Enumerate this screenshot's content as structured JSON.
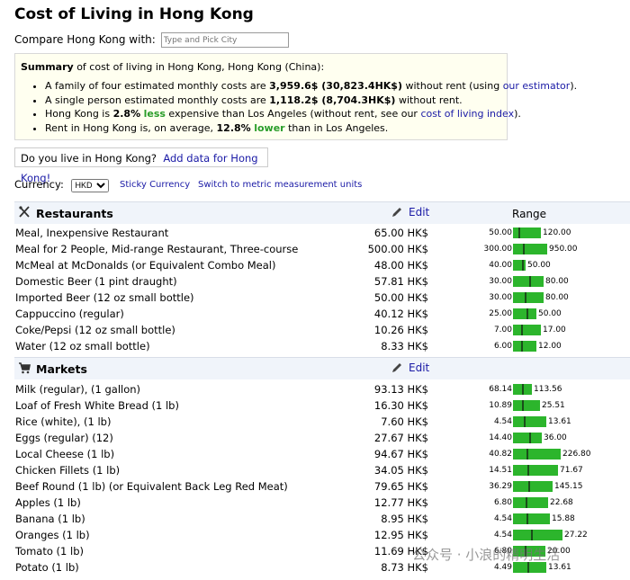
{
  "title": "Cost of Living in Hong Kong",
  "compare": {
    "label": "Compare Hong Kong with:",
    "placeholder": "Type and Pick City"
  },
  "summary": {
    "head_bold": "Summary",
    "head_rest": " of cost of living in Hong Kong, Hong Kong (China):",
    "l1_a": "A family of four estimated monthly costs are ",
    "l1_b": "3,959.6$ (30,823.4HK$)",
    "l1_c": " without rent (using ",
    "l1_link": "our estimator",
    "l1_d": ").",
    "l2_a": "A single person estimated monthly costs are ",
    "l2_b": "1,118.2$ (8,704.3HK$)",
    "l2_c": " without rent.",
    "l3_a": "Hong Kong is ",
    "l3_b": "2.8%",
    "l3_green": "less",
    "l3_c": " expensive than Los Angeles (without rent, see our ",
    "l3_link": "cost of living index",
    "l3_d": ").",
    "l4_a": "Rent in Hong Kong is, on average, ",
    "l4_b": "12.8%",
    "l4_green": "lower",
    "l4_c": " than in Los Angeles."
  },
  "live": {
    "text": "Do you live in Hong Kong?",
    "link": "Add data for Hong Kong!"
  },
  "currency": {
    "label": "Currency:",
    "value": "HKD",
    "sticky": "Sticky Currency",
    "metric": "Switch to metric measurement units"
  },
  "restaurants": {
    "title": "Restaurants",
    "edit": "Edit",
    "range": "Range",
    "rows": [
      {
        "name": "Meal, Inexpensive Restaurant",
        "price": "65.00 HK$",
        "lo": "50.00",
        "hi": "120.00",
        "lo_v": 50,
        "avg_v": 65,
        "hi_v": 120
      },
      {
        "name": "Meal for 2 People, Mid-range Restaurant, Three-course",
        "price": "500.00 HK$",
        "lo": "300.00",
        "hi": "950.00",
        "lo_v": 300,
        "avg_v": 500,
        "hi_v": 950
      },
      {
        "name": "McMeal at McDonalds (or Equivalent Combo Meal)",
        "price": "48.00 HK$",
        "lo": "40.00",
        "hi": "50.00",
        "lo_v": 40,
        "avg_v": 48,
        "hi_v": 50
      },
      {
        "name": "Domestic Beer (1 pint draught)",
        "price": "57.81 HK$",
        "lo": "30.00",
        "hi": "80.00",
        "lo_v": 30,
        "avg_v": 57.81,
        "hi_v": 80
      },
      {
        "name": "Imported Beer (12 oz small bottle)",
        "price": "50.00 HK$",
        "lo": "30.00",
        "hi": "80.00",
        "lo_v": 30,
        "avg_v": 50,
        "hi_v": 80
      },
      {
        "name": "Cappuccino (regular)",
        "price": "40.12 HK$",
        "lo": "25.00",
        "hi": "50.00",
        "lo_v": 25,
        "avg_v": 40.12,
        "hi_v": 50
      },
      {
        "name": "Coke/Pepsi (12 oz small bottle)",
        "price": "10.26 HK$",
        "lo": "7.00",
        "hi": "17.00",
        "lo_v": 7,
        "avg_v": 10.26,
        "hi_v": 17
      },
      {
        "name": "Water (12 oz small bottle)",
        "price": "8.33 HK$",
        "lo": "6.00",
        "hi": "12.00",
        "lo_v": 6,
        "avg_v": 8.33,
        "hi_v": 12
      }
    ]
  },
  "markets": {
    "title": "Markets",
    "edit": "Edit",
    "rows": [
      {
        "name": "Milk (regular), (1 gallon)",
        "price": "93.13 HK$",
        "lo": "68.14",
        "hi": "113.56",
        "lo_v": 68.14,
        "avg_v": 93.13,
        "hi_v": 113.56
      },
      {
        "name": "Loaf of Fresh White Bread (1 lb)",
        "price": "16.30 HK$",
        "lo": "10.89",
        "hi": "25.51",
        "lo_v": 10.89,
        "avg_v": 16.3,
        "hi_v": 25.51
      },
      {
        "name": "Rice (white), (1 lb)",
        "price": "7.60 HK$",
        "lo": "4.54",
        "hi": "13.61",
        "lo_v": 4.54,
        "avg_v": 7.6,
        "hi_v": 13.61
      },
      {
        "name": "Eggs (regular) (12)",
        "price": "27.67 HK$",
        "lo": "14.40",
        "hi": "36.00",
        "lo_v": 14.4,
        "avg_v": 27.67,
        "hi_v": 36
      },
      {
        "name": "Local Cheese (1 lb)",
        "price": "94.67 HK$",
        "lo": "40.82",
        "hi": "226.80",
        "lo_v": 40.82,
        "avg_v": 94.67,
        "hi_v": 226.8
      },
      {
        "name": "Chicken Fillets (1 lb)",
        "price": "34.05 HK$",
        "lo": "14.51",
        "hi": "71.67",
        "lo_v": 14.51,
        "avg_v": 34.05,
        "hi_v": 71.67
      },
      {
        "name": "Beef Round (1 lb) (or Equivalent Back Leg Red Meat)",
        "price": "79.65 HK$",
        "lo": "36.29",
        "hi": "145.15",
        "lo_v": 36.29,
        "avg_v": 79.65,
        "hi_v": 145.15
      },
      {
        "name": "Apples (1 lb)",
        "price": "12.77 HK$",
        "lo": "6.80",
        "hi": "22.68",
        "lo_v": 6.8,
        "avg_v": 12.77,
        "hi_v": 22.68
      },
      {
        "name": "Banana (1 lb)",
        "price": "8.95 HK$",
        "lo": "4.54",
        "hi": "15.88",
        "lo_v": 4.54,
        "avg_v": 8.95,
        "hi_v": 15.88
      },
      {
        "name": "Oranges (1 lb)",
        "price": "12.95 HK$",
        "lo": "4.54",
        "hi": "27.22",
        "lo_v": 4.54,
        "avg_v": 12.95,
        "hi_v": 27.22
      },
      {
        "name": "Tomato (1 lb)",
        "price": "11.69 HK$",
        "lo": "6.80",
        "hi": "20.00",
        "lo_v": 6.8,
        "avg_v": 11.69,
        "hi_v": 20
      },
      {
        "name": "Potato (1 lb)",
        "price": "8.73 HK$",
        "lo": "4.49",
        "hi": "13.61",
        "lo_v": 4.49,
        "avg_v": 8.73,
        "hi_v": 13.61
      }
    ]
  },
  "watermark": "公众号 · 小浪的精明生活"
}
